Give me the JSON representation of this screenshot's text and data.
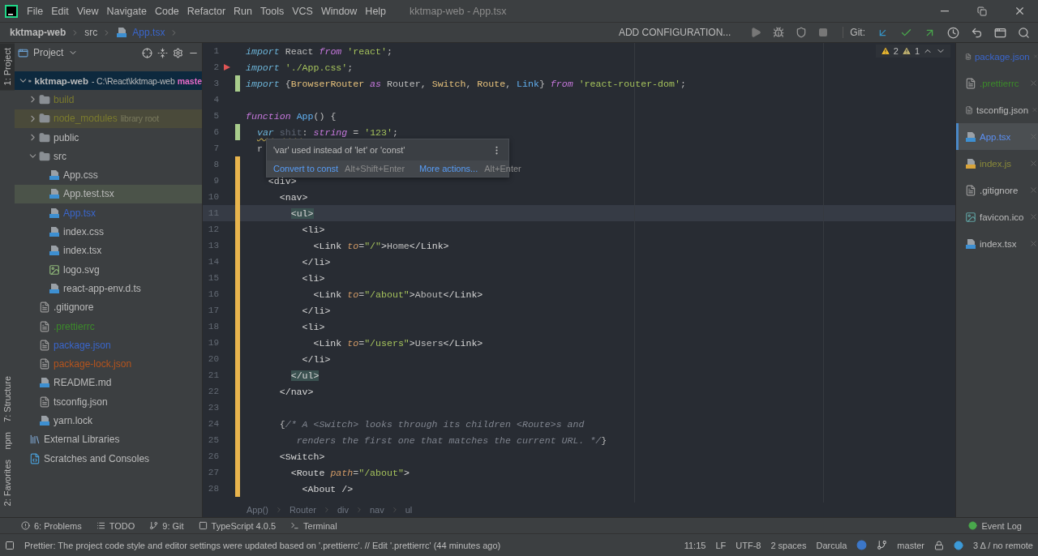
{
  "menu": [
    "File",
    "Edit",
    "View",
    "Navigate",
    "Code",
    "Refactor",
    "Run",
    "Tools",
    "VCS",
    "Window",
    "Help"
  ],
  "window": {
    "title": "kktmap-web - App.tsx"
  },
  "navbar": {
    "crumbs": [
      {
        "text": "kktmap-web",
        "kind": "project"
      },
      {
        "text": "src",
        "kind": "folder"
      },
      {
        "text": "App.tsx",
        "kind": "file"
      }
    ],
    "config": "ADD CONFIGURATION...",
    "git_label": "Git:"
  },
  "left_stripe": [
    {
      "label": "1: Project",
      "selected": true
    },
    {
      "label": "7: Structure",
      "selected": false
    },
    {
      "label": "npm",
      "selected": false
    },
    {
      "label": "2: Favorites",
      "selected": false
    }
  ],
  "project": {
    "title": "Project",
    "tree": [
      {
        "name": "kktmap-web",
        "kind": "project",
        "expanded": true,
        "selected": false,
        "note": "- C:\\React\\kktmap-web",
        "branch": "maste",
        "children": [
          {
            "name": "build",
            "kind": "folder",
            "expanded": false,
            "selected": false,
            "color": "#7b7b2e"
          },
          {
            "name": "node_modules",
            "kind": "library",
            "expanded": false,
            "selected": false,
            "color": "#7b7b2e",
            "note": "library root"
          },
          {
            "name": "public",
            "kind": "folder",
            "expanded": false,
            "selected": false
          },
          {
            "name": "src",
            "kind": "folder",
            "expanded": true,
            "selected": false,
            "children": [
              {
                "name": "App.css",
                "kind": "css",
                "selected": false
              },
              {
                "name": "App.test.tsx",
                "kind": "tsx",
                "selected": true
              },
              {
                "name": "App.tsx",
                "kind": "tsx",
                "selected": false,
                "color": "#3a66cc"
              },
              {
                "name": "index.css",
                "kind": "css",
                "selected": false
              },
              {
                "name": "index.tsx",
                "kind": "tsx",
                "selected": false
              },
              {
                "name": "logo.svg",
                "kind": "svg",
                "selected": false
              },
              {
                "name": "react-app-env.d.ts",
                "kind": "ts",
                "selected": false
              }
            ]
          },
          {
            "name": ".gitignore",
            "kind": "config",
            "selected": false
          },
          {
            "name": ".prettierrc",
            "kind": "config",
            "selected": false,
            "color": "#3c8a2a"
          },
          {
            "name": "package.json",
            "kind": "config",
            "selected": false,
            "color": "#3a66cc"
          },
          {
            "name": "package-lock.json",
            "kind": "config",
            "selected": false,
            "color": "#b5541d"
          },
          {
            "name": "README.md",
            "kind": "md",
            "selected": false
          },
          {
            "name": "tsconfig.json",
            "kind": "config",
            "selected": false
          },
          {
            "name": "yarn.lock",
            "kind": "yarn",
            "selected": false
          }
        ]
      },
      {
        "name": "External Libraries",
        "kind": "libraries",
        "selected": false
      },
      {
        "name": "Scratches and Consoles",
        "kind": "scratches",
        "selected": false
      }
    ]
  },
  "inspections": {
    "warnings": "2",
    "weak_warnings": "1"
  },
  "editor": {
    "lines": [
      {
        "number": "1",
        "current": false,
        "tokens": [
          {
            "kind": "storage",
            "text": "import"
          },
          {
            "kind": "plain",
            "text": " React "
          },
          {
            "kind": "keyword",
            "text": "from"
          },
          {
            "kind": "string",
            "text": " 'react'"
          },
          {
            "kind": "plain",
            "text": ";"
          }
        ]
      },
      {
        "number": "2",
        "current": false,
        "arrow_marker": true,
        "tokens": [
          {
            "kind": "storage",
            "text": "import"
          },
          {
            "kind": "string",
            "text": " './App.css'"
          },
          {
            "kind": "plain",
            "text": ";"
          }
        ]
      },
      {
        "number": "3",
        "current": false,
        "color": "#a8cc8c",
        "tokens": [
          {
            "kind": "storage",
            "text": "import"
          },
          {
            "kind": "plain",
            "text": " {"
          },
          {
            "kind": "class",
            "text": "BrowserRouter"
          },
          {
            "kind": "keyword",
            "text": " as"
          },
          {
            "kind": "plain",
            "text": " Router, "
          },
          {
            "kind": "class",
            "text": "Switch"
          },
          {
            "kind": "plain",
            "text": ", "
          },
          {
            "kind": "class",
            "text": "Route"
          },
          {
            "kind": "plain",
            "text": ", "
          },
          {
            "kind": "function",
            "text": "Link"
          },
          {
            "kind": "plain",
            "text": "} "
          },
          {
            "kind": "keyword",
            "text": "from"
          },
          {
            "kind": "string",
            "text": " 'react-router-dom'"
          },
          {
            "kind": "plain",
            "text": ";"
          }
        ]
      },
      {
        "number": "4",
        "current": false
      },
      {
        "number": "5",
        "current": false,
        "tokens": [
          {
            "kind": "keyword",
            "text": "function"
          },
          {
            "kind": "function",
            "text": " App"
          },
          {
            "kind": "plain",
            "text": "() {"
          }
        ]
      },
      {
        "number": "6",
        "current": false,
        "color": "#a8cc8c",
        "tokens": [
          {
            "kind": "storage",
            "text": "  var",
            "warn": true
          },
          {
            "kind": "unused",
            "text": " shit",
            "warn": true
          },
          {
            "kind": "plain",
            "text": ": "
          },
          {
            "kind": "keyword",
            "text": "string"
          },
          {
            "kind": "plain",
            "text": " = "
          },
          {
            "kind": "string",
            "text": "'123'"
          },
          {
            "kind": "plain",
            "text": ";"
          }
        ]
      },
      {
        "number": "7",
        "current": false,
        "tokens": [
          {
            "kind": "plain",
            "text": "  r"
          }
        ]
      },
      {
        "number": "8",
        "current": false,
        "color": "#e8b44d"
      },
      {
        "number": "9",
        "current": false,
        "color": "#e8b44d",
        "tokens": [
          {
            "kind": "tag",
            "text": "    <div>"
          }
        ]
      },
      {
        "number": "10",
        "current": false,
        "color": "#e8b44d",
        "tokens": [
          {
            "kind": "tag",
            "text": "      <nav>"
          }
        ]
      },
      {
        "number": "11",
        "current": true,
        "color": "#e8b44d",
        "tokens": [
          {
            "kind": "tagmatch",
            "text": "        <ul>"
          }
        ]
      },
      {
        "number": "12",
        "current": false,
        "color": "#e8b44d",
        "tokens": [
          {
            "kind": "tag",
            "text": "          <li>"
          }
        ]
      },
      {
        "number": "13",
        "current": false,
        "color": "#e8b44d",
        "tokens": [
          {
            "kind": "tag",
            "text": "            <Link"
          },
          {
            "kind": "attr",
            "text": " to"
          },
          {
            "kind": "plain",
            "text": "="
          },
          {
            "kind": "string",
            "text": "\"/\""
          },
          {
            "kind": "tag",
            "text": ">"
          },
          {
            "kind": "plain",
            "text": "Home"
          },
          {
            "kind": "tag",
            "text": "</Link>"
          }
        ]
      },
      {
        "number": "14",
        "current": false,
        "color": "#e8b44d",
        "tokens": [
          {
            "kind": "tag",
            "text": "          </li>"
          }
        ]
      },
      {
        "number": "15",
        "current": false,
        "color": "#e8b44d",
        "tokens": [
          {
            "kind": "tag",
            "text": "          <li>"
          }
        ]
      },
      {
        "number": "16",
        "current": false,
        "color": "#e8b44d",
        "tokens": [
          {
            "kind": "tag",
            "text": "            <Link"
          },
          {
            "kind": "attr",
            "text": " to"
          },
          {
            "kind": "plain",
            "text": "="
          },
          {
            "kind": "string",
            "text": "\"/about\""
          },
          {
            "kind": "tag",
            "text": ">"
          },
          {
            "kind": "plain",
            "text": "About"
          },
          {
            "kind": "tag",
            "text": "</Link>"
          }
        ]
      },
      {
        "number": "17",
        "current": false,
        "color": "#e8b44d",
        "tokens": [
          {
            "kind": "tag",
            "text": "          </li>"
          }
        ]
      },
      {
        "number": "18",
        "current": false,
        "color": "#e8b44d",
        "tokens": [
          {
            "kind": "tag",
            "text": "          <li>"
          }
        ]
      },
      {
        "number": "19",
        "current": false,
        "color": "#e8b44d",
        "tokens": [
          {
            "kind": "tag",
            "text": "            <Link"
          },
          {
            "kind": "attr",
            "text": " to"
          },
          {
            "kind": "plain",
            "text": "="
          },
          {
            "kind": "string",
            "text": "\"/users\""
          },
          {
            "kind": "tag",
            "text": ">"
          },
          {
            "kind": "plain",
            "text": "Users"
          },
          {
            "kind": "tag",
            "text": "</Link>"
          }
        ]
      },
      {
        "number": "20",
        "current": false,
        "color": "#e8b44d",
        "tokens": [
          {
            "kind": "tag",
            "text": "          </li>"
          }
        ]
      },
      {
        "number": "21",
        "current": false,
        "color": "#e8b44d",
        "tokens": [
          {
            "kind": "tagmatch",
            "text": "        </ul>"
          }
        ]
      },
      {
        "number": "22",
        "current": false,
        "color": "#e8b44d",
        "tokens": [
          {
            "kind": "tag",
            "text": "      </nav>"
          }
        ]
      },
      {
        "number": "23",
        "current": false,
        "color": "#e8b44d"
      },
      {
        "number": "24",
        "current": false,
        "color": "#e8b44d",
        "tokens": [
          {
            "kind": "plain",
            "text": "      {"
          },
          {
            "kind": "comment",
            "text": "/* A <Switch> looks through its children <Route>s and"
          }
        ]
      },
      {
        "number": "25",
        "current": false,
        "color": "#e8b44d",
        "tokens": [
          {
            "kind": "comment",
            "text": "         renders the first one that matches the current URL. */"
          },
          {
            "kind": "plain",
            "text": "}"
          }
        ]
      },
      {
        "number": "26",
        "current": false,
        "color": "#e8b44d",
        "tokens": [
          {
            "kind": "tag",
            "text": "      <Switch>"
          }
        ]
      },
      {
        "number": "27",
        "current": false,
        "color": "#e8b44d",
        "tokens": [
          {
            "kind": "tag",
            "text": "        <Route"
          },
          {
            "kind": "attr",
            "text": " path"
          },
          {
            "kind": "plain",
            "text": "="
          },
          {
            "kind": "string",
            "text": "\"/about\""
          },
          {
            "kind": "tag",
            "text": ">"
          }
        ]
      },
      {
        "number": "28",
        "current": false,
        "color": "#e8b44d",
        "tokens": [
          {
            "kind": "tag",
            "text": "          <About />"
          }
        ]
      }
    ],
    "popup": {
      "message": "'var' used instead of 'let' or 'const'",
      "actions": [
        {
          "label": "Convert to const",
          "shortcut": "Alt+Shift+Enter"
        },
        {
          "label": "More actions...",
          "shortcut": "Alt+Enter"
        }
      ]
    },
    "breadcrumbs": [
      "App()",
      "Router",
      "div",
      "nav",
      "ul"
    ]
  },
  "open_files": [
    {
      "name": "package.json",
      "kind": "config",
      "selected": false,
      "color": "#3a66cc"
    },
    {
      "name": ".prettierrc",
      "kind": "config",
      "selected": false,
      "color": "#3c8a2a"
    },
    {
      "name": "tsconfig.json",
      "kind": "config",
      "selected": false
    },
    {
      "name": "App.tsx",
      "kind": "tsx",
      "selected": true,
      "color": "#5b8ff0"
    },
    {
      "name": "index.js",
      "kind": "js",
      "selected": false,
      "color": "#8a8a3a"
    },
    {
      "name": ".gitignore",
      "kind": "config",
      "selected": false
    },
    {
      "name": "favicon.ico",
      "kind": "image",
      "selected": false
    },
    {
      "name": "index.tsx",
      "kind": "tsx",
      "selected": false
    }
  ],
  "tool_windows": [
    {
      "label": "6: Problems",
      "kind": "problems"
    },
    {
      "label": "TODO",
      "kind": "todo"
    },
    {
      "label": "9: Git",
      "kind": "git"
    },
    {
      "label": "TypeScript 4.0.5",
      "kind": "typescript"
    },
    {
      "label": "Terminal",
      "kind": "terminal"
    }
  ],
  "event_log": "Event Log",
  "status_bar": {
    "message": "Prettier: The project code style and editor settings were updated based on '.prettierrc'. // Edit '.prettierrc' (44 minutes ago)",
    "position": "11:15",
    "line_sep": "LF",
    "encoding": "UTF-8",
    "indent": "2 spaces",
    "theme": "Darcula",
    "branch": "master",
    "changes": "3 Δ / no remote"
  }
}
